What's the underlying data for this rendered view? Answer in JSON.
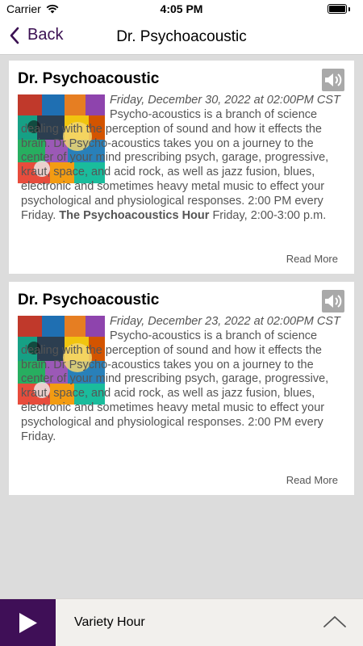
{
  "status": {
    "carrier": "Carrier",
    "time": "4:05 PM"
  },
  "nav": {
    "back_label": "Back",
    "title": "Dr. Psychoacoustic"
  },
  "episodes": [
    {
      "title": "Dr. Psychoacoustic",
      "date": "Friday, December 30, 2022 at 02:00PM CST",
      "body": "Psycho-acoustics is a branch of science dealing with the perception of sound and how it effects the brain. Dr Psycho-acoustics takes you on a journey to the center of your mind prescribing psych, garage, progressive, kraut, space, and acid rock, as well as jazz fusion, blues, electronic and sometimes heavy metal music to effect your psychological and physiological responses. 2:00 PM every Friday.",
      "body_bold": "The Psychoacoustics Hour",
      "body_tail": "Friday, 2:00-3:00 p.m.",
      "read_more": "Read More"
    },
    {
      "title": "Dr. Psychoacoustic",
      "date": "Friday, December 23, 2022 at 02:00PM CST",
      "body": "Psycho-acoustics is a branch of science dealing with the perception of sound and how it effects the brain. Dr Psycho-acoustics takes you on a journey to the center of your mind prescribing psych, garage, progressive, kraut, space, and acid rock, as well as jazz fusion, blues, electronic and sometimes heavy metal music to effect your psychological and physiological responses. 2:00 PM every Friday.",
      "read_more": "Read More"
    }
  ],
  "player": {
    "now_playing": "Variety Hour"
  },
  "icons": [
    "wifi-icon",
    "battery-icon",
    "chevron-left-icon",
    "speaker-icon",
    "play-icon",
    "chevron-up-icon"
  ],
  "colors": {
    "accent": "#3f0f57",
    "back": "#3b1053",
    "speaker": "#a9a9a9",
    "background": "#dcdcdc"
  }
}
